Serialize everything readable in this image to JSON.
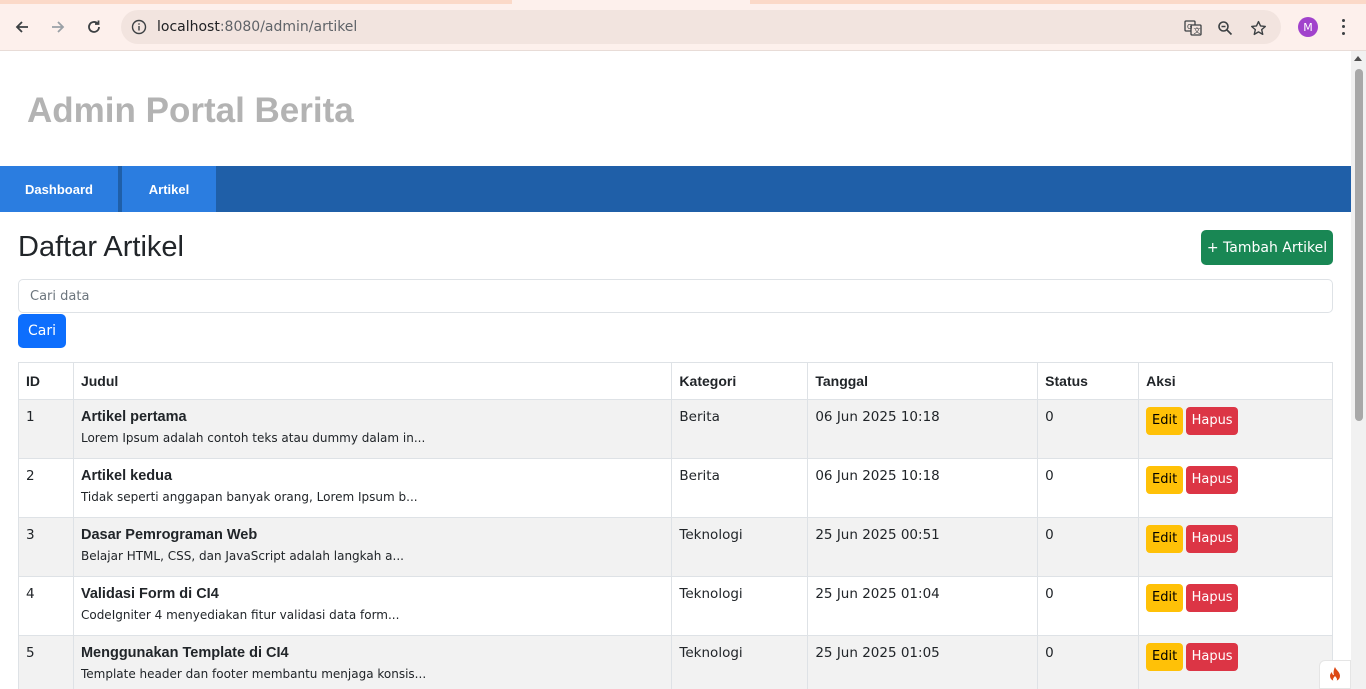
{
  "browser": {
    "url_host": "localhost",
    "url_rest": ":8080/admin/artikel",
    "avatar_letter": "M",
    "icons": [
      "back-icon",
      "forward-icon",
      "reload-icon",
      "site-info-icon",
      "translate-icon",
      "zoom-icon",
      "bookmark-star-icon",
      "menu-kebab-icon"
    ]
  },
  "site": {
    "title": "Admin Portal Berita"
  },
  "nav": {
    "items": [
      {
        "label": "Dashboard"
      },
      {
        "label": "Artikel"
      }
    ]
  },
  "main": {
    "heading": "Daftar Artikel",
    "add_button": "+ Tambah Artikel",
    "search_placeholder": "Cari data",
    "search_button": "Cari"
  },
  "table": {
    "headers": [
      "ID",
      "Judul",
      "Kategori",
      "Tanggal",
      "Status",
      "Aksi"
    ],
    "rows": [
      {
        "id": "1",
        "title": "Artikel pertama",
        "excerpt": "Lorem Ipsum adalah contoh teks atau dummy dalam in...",
        "category": "Berita",
        "date": "06 Jun 2025 10:18",
        "status": "0",
        "edit": "Edit",
        "delete": "Hapus"
      },
      {
        "id": "2",
        "title": "Artikel kedua",
        "excerpt": "Tidak seperti anggapan banyak orang, Lorem Ipsum b...",
        "category": "Berita",
        "date": "06 Jun 2025 10:18",
        "status": "0",
        "edit": "Edit",
        "delete": "Hapus"
      },
      {
        "id": "3",
        "title": "Dasar Pemrograman Web",
        "excerpt": "Belajar HTML, CSS, dan JavaScript adalah langkah a...",
        "category": "Teknologi",
        "date": "25 Jun 2025 00:51",
        "status": "0",
        "edit": "Edit",
        "delete": "Hapus"
      },
      {
        "id": "4",
        "title": "Validasi Form di CI4",
        "excerpt": "CodeIgniter 4 menyediakan fitur validasi data form...",
        "category": "Teknologi",
        "date": "25 Jun 2025 01:04",
        "status": "0",
        "edit": "Edit",
        "delete": "Hapus"
      },
      {
        "id": "5",
        "title": "Menggunakan Template di CI4",
        "excerpt": "Template header dan footer membantu menjaga konsis...",
        "category": "Teknologi",
        "date": "25 Jun 2025 01:05",
        "status": "0",
        "edit": "Edit",
        "delete": "Hapus"
      }
    ]
  },
  "colors": {
    "nav_bg": "#1f5fa8",
    "nav_tab": "#2b7de0",
    "add_button": "#198754",
    "search_button": "#0d6efd",
    "edit_button": "#ffc107",
    "delete_button": "#dc3545"
  }
}
